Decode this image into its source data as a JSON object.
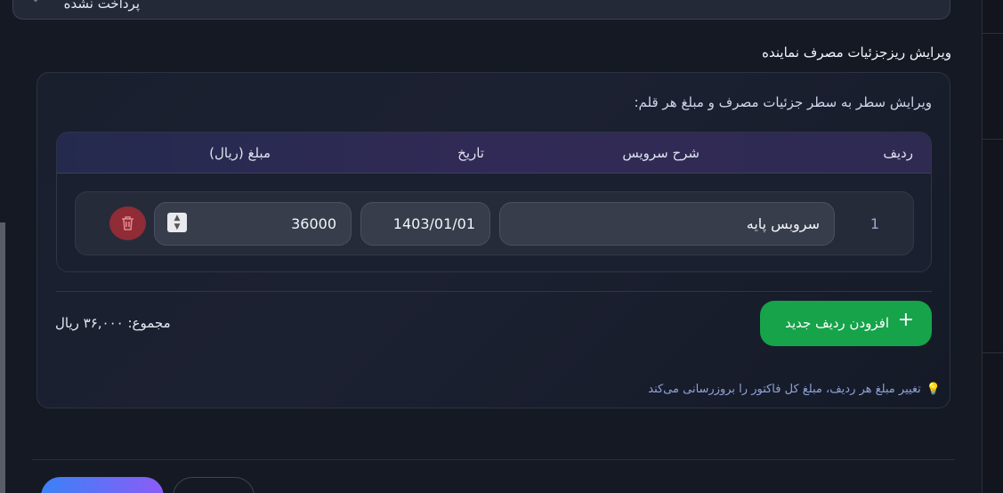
{
  "status_select": {
    "value": "پرداخت نشده"
  },
  "section": {
    "title": "ویرایش ریزجزئیات مصرف نماینده"
  },
  "panel": {
    "description": "ویرایش سطر به سطر جزئیات مصرف و مبلغ هر قلم:",
    "columns": {
      "row": "ردیف",
      "service": "شرح سرویس",
      "date": "تاریخ",
      "amount": "مبلغ (ریال)"
    },
    "rows": [
      {
        "num": "1",
        "service": "سروبس پایه",
        "date": "1403/01/01",
        "amount": "36000"
      }
    ],
    "add_button": "افزودن ردیف جدید",
    "add_icon": "+",
    "total": "مجموع: ۳۶,۰۰۰ ریال",
    "hint_icon": "💡",
    "hint": "تغییر مبلغ هر ردیف، مبلغ کل فاکتور را بروزرسانی می‌کند"
  },
  "colors": {
    "accent_green": "#16a34a",
    "delete_red": "#8f2c36",
    "header_purple": "#312a56"
  }
}
